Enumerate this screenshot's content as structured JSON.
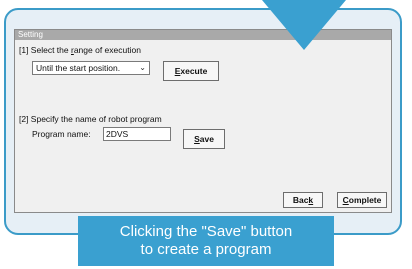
{
  "window": {
    "title": "Setting"
  },
  "section1": {
    "label_prefix": "[1] Select the ",
    "label_hotkey": "r",
    "label_suffix": "ange of execution",
    "dropdown_value": "Until the start position.",
    "execute_hotkey": "E",
    "execute_rest": "xecute"
  },
  "section2": {
    "label": "[2] Specify the name of robot program",
    "program_label": "Program name:",
    "program_value": "2DVS",
    "save_hotkey": "S",
    "save_rest": "ave"
  },
  "footer": {
    "back_pre": "Bac",
    "back_hotkey": "k",
    "complete_hotkey": "C",
    "complete_rest": "omplete"
  },
  "caption": {
    "line1": "Clicking the \"Save\" button",
    "line2": "to create a program"
  },
  "colors": {
    "accent": "#3aa0d0",
    "frame_bg": "#e6eff6",
    "window_bg": "#f0f0f0",
    "titlebar": "#a9a9a9"
  },
  "icons": {
    "dropdown": "chevron-down-icon",
    "pointer": "down-arrow-pointer"
  }
}
